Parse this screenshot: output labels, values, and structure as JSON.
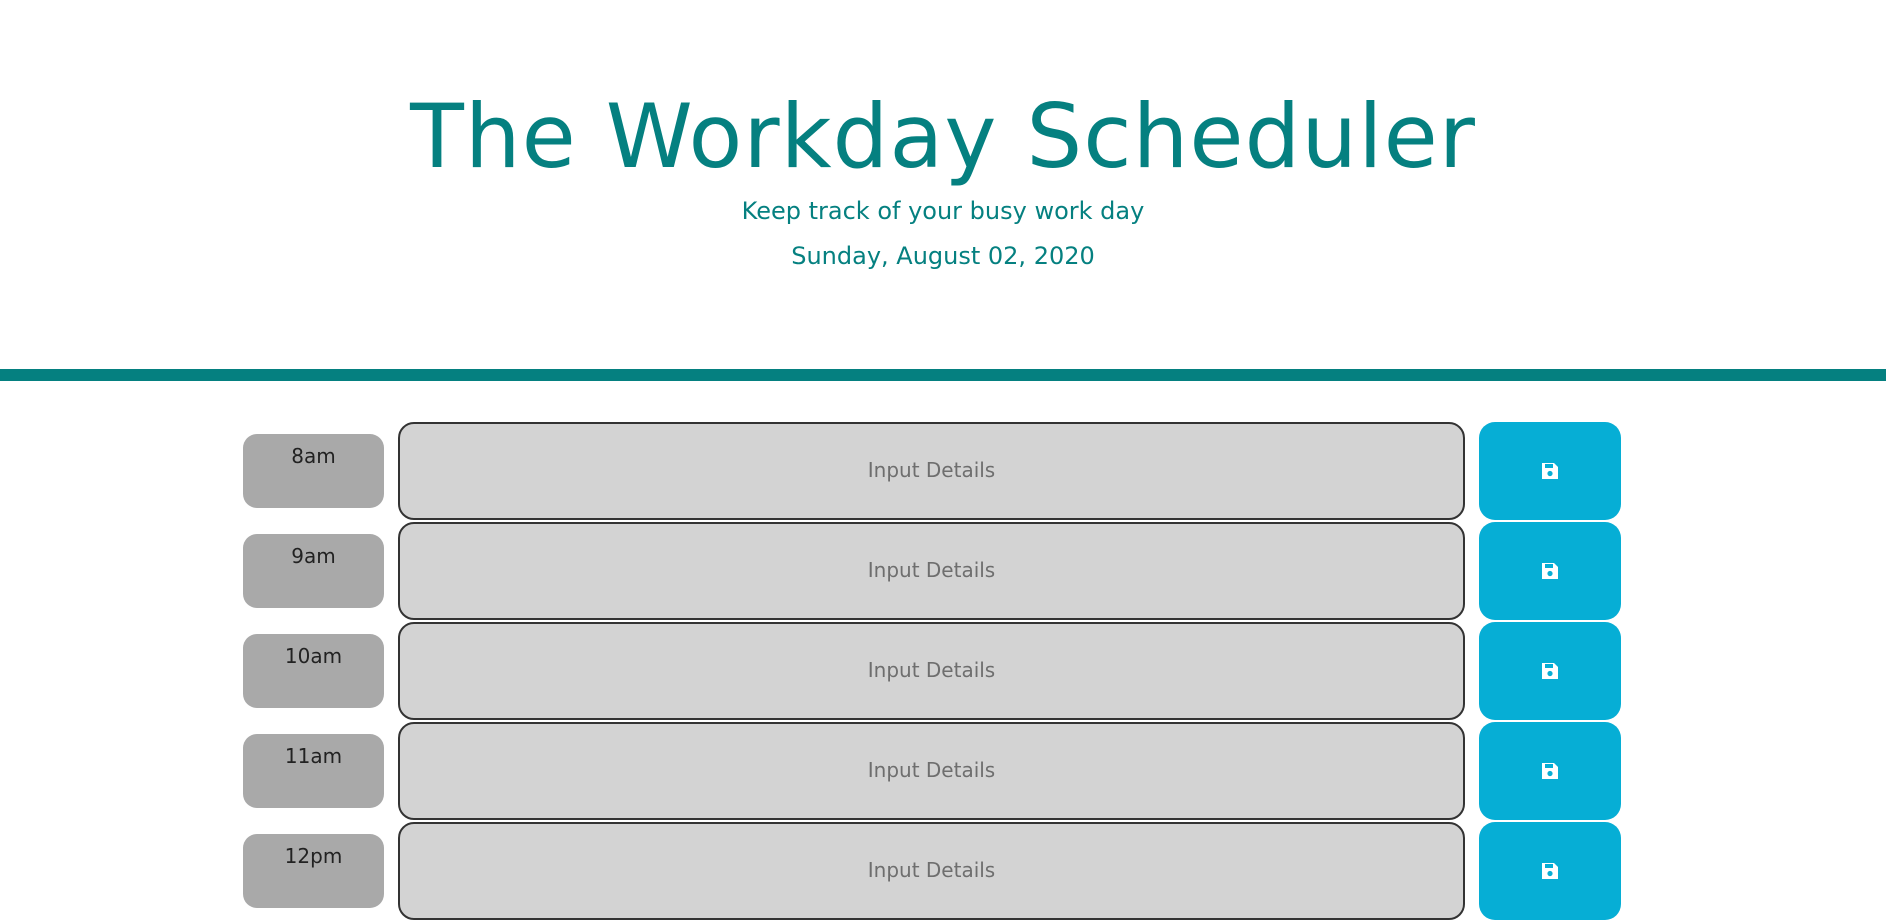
{
  "header": {
    "title": "The Workday Scheduler",
    "subtitle": "Keep track of your busy work day",
    "date": "Sunday, August 02, 2020"
  },
  "colors": {
    "accent": "#058080",
    "hour_block": "#a9a9a9",
    "textarea_bg": "#d3d3d3",
    "save_button": "#06aed5"
  },
  "rows": [
    {
      "hour": "8am",
      "placeholder": "Input Details",
      "save_icon": "save-icon"
    },
    {
      "hour": "9am",
      "placeholder": "Input Details",
      "save_icon": "save-icon"
    },
    {
      "hour": "10am",
      "placeholder": "Input Details",
      "save_icon": "save-icon"
    },
    {
      "hour": "11am",
      "placeholder": "Input Details",
      "save_icon": "save-icon"
    },
    {
      "hour": "12pm",
      "placeholder": "Input Details",
      "save_icon": "save-icon"
    }
  ]
}
